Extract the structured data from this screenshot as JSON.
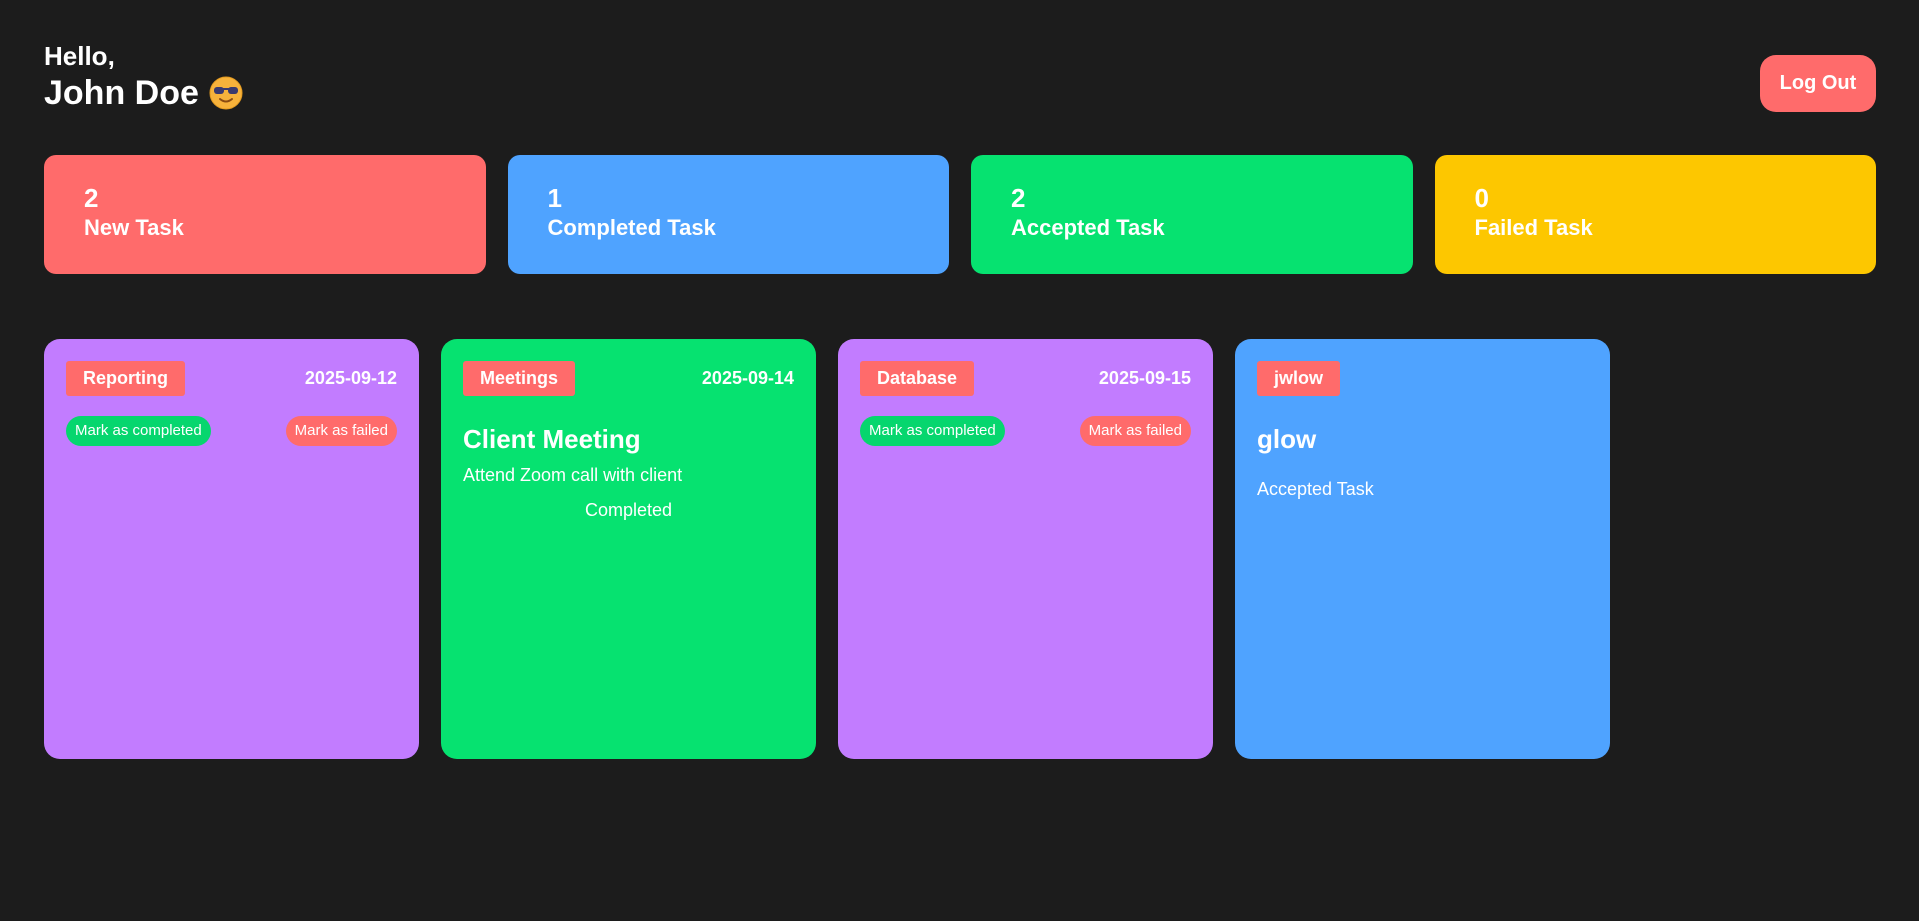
{
  "header": {
    "greeting": "Hello,",
    "user_name": "John Doe",
    "logout_label": "Log Out"
  },
  "colors": {
    "background": "#1c1c1c",
    "red": "#ff6b6b",
    "blue": "#4fa3ff",
    "green": "#06e270",
    "yellow": "#fdc700",
    "purple": "#c27cff"
  },
  "stats": [
    {
      "count": "2",
      "label": "New Task",
      "color": "#ff6b6b"
    },
    {
      "count": "1",
      "label": "Completed Task",
      "color": "#4fa3ff"
    },
    {
      "count": "2",
      "label": "Accepted Task",
      "color": "#06e270"
    },
    {
      "count": "0",
      "label": "Failed Task",
      "color": "#fdc700"
    }
  ],
  "tasks": [
    {
      "category": "Reporting",
      "date": "2025-09-12",
      "color": "#c27cff",
      "complete_label": "Mark as completed",
      "failed_label": "Mark as failed"
    },
    {
      "category": "Meetings",
      "date": "2025-09-14",
      "color": "#06e270",
      "title": "Client Meeting",
      "description": "Attend Zoom call with client",
      "status": "Completed"
    },
    {
      "category": "Database",
      "date": "2025-09-15",
      "color": "#c27cff",
      "complete_label": "Mark as completed",
      "failed_label": "Mark as failed"
    },
    {
      "category": "jwlow",
      "color": "#4fa3ff",
      "title": "glow",
      "status": "Accepted Task"
    }
  ]
}
